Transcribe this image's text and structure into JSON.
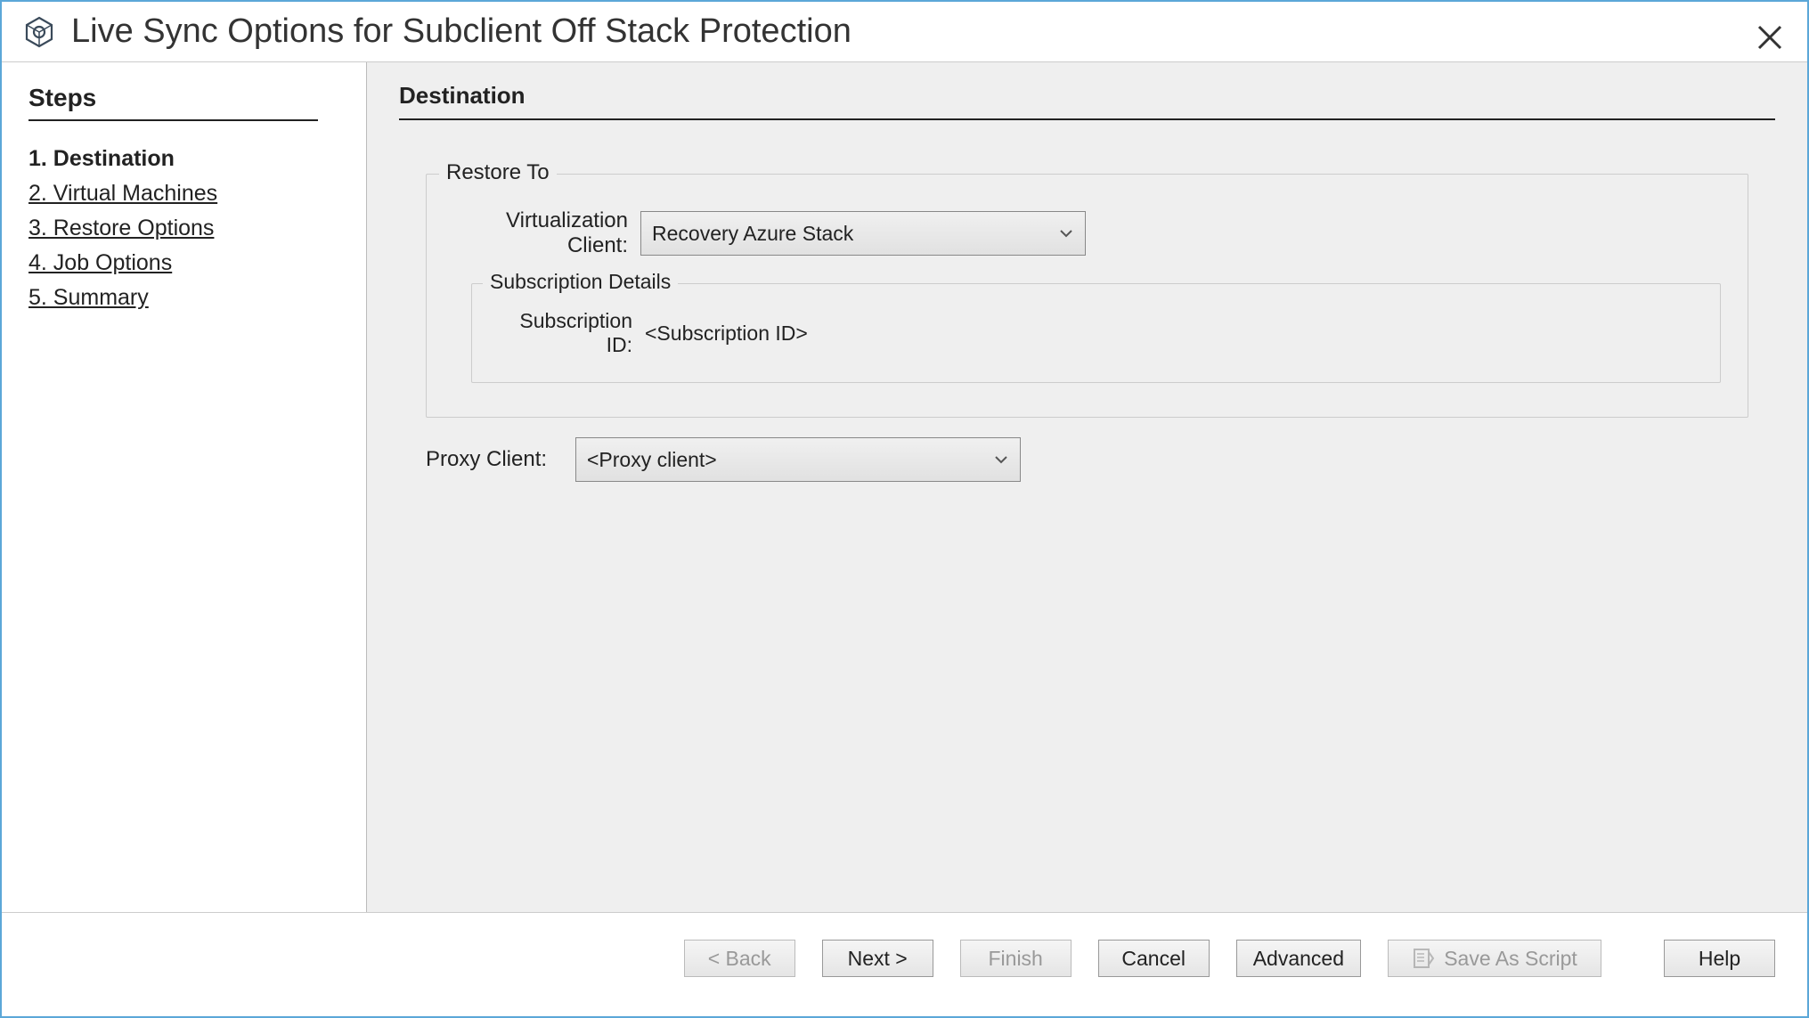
{
  "titlebar": {
    "title": "Live Sync Options for Subclient Off Stack Protection"
  },
  "sidebar": {
    "header": "Steps",
    "items": [
      {
        "label": "1. Destination",
        "active": true
      },
      {
        "label": "2. Virtual Machines",
        "active": false
      },
      {
        "label": "3. Restore Options",
        "active": false
      },
      {
        "label": "4. Job Options",
        "active": false
      },
      {
        "label": "5. Summary",
        "active": false
      }
    ]
  },
  "main": {
    "header": "Destination",
    "restore_to": {
      "legend": "Restore To",
      "virtualization_client_label": "Virtualization Client:",
      "virtualization_client_value": "Recovery Azure Stack",
      "subscription_details": {
        "legend": "Subscription Details",
        "subscription_id_label": "Subscription ID:",
        "subscription_id_value": "<Subscription ID>"
      }
    },
    "proxy_client_label": "Proxy Client:",
    "proxy_client_value": "<Proxy client>"
  },
  "footer": {
    "back": "< Back",
    "next": "Next >",
    "finish": "Finish",
    "cancel": "Cancel",
    "advanced": "Advanced",
    "save_as_script": "Save As Script",
    "help": "Help"
  }
}
